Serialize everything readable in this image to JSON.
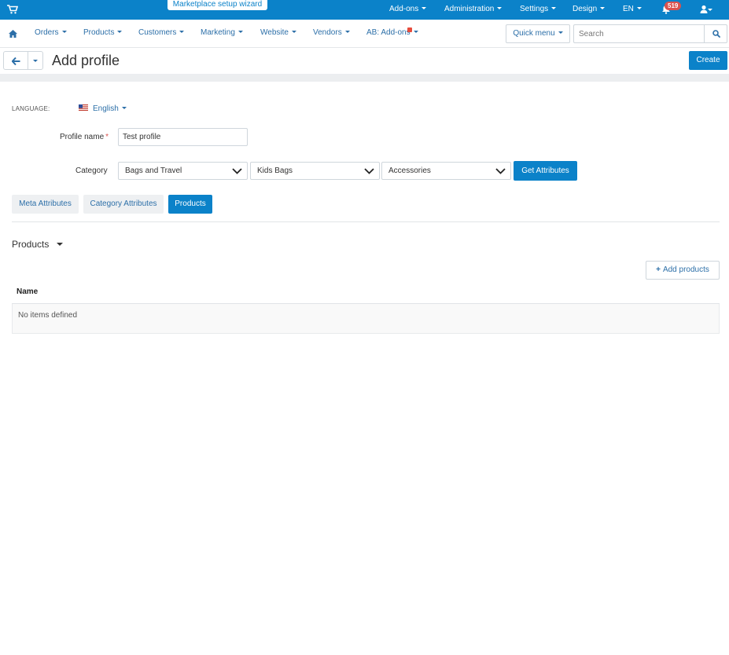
{
  "topbar": {
    "wizard_label": "Marketplace setup wizard",
    "menu": [
      "Add-ons",
      "Administration",
      "Settings",
      "Design",
      "EN"
    ],
    "notification_count": "519",
    "icons": [
      "cart-icon",
      "bell-icon",
      "user-icon"
    ]
  },
  "nav": {
    "items": [
      "Orders",
      "Products",
      "Customers",
      "Marketing",
      "Website",
      "Vendors",
      "AB: Add-ons"
    ],
    "quick_menu_label": "Quick menu",
    "search_placeholder": "Search"
  },
  "title_bar": {
    "title": "Add profile",
    "create_label": "Create"
  },
  "form": {
    "language_label": "LANGUAGE:",
    "language_value": "English",
    "profile_name_label": "Profile name",
    "required_mark": "*",
    "profile_name_value": "Test profile",
    "category_label": "Category",
    "category_selects": [
      "Bags and Travel",
      "Kids Bags",
      "Accessories"
    ],
    "get_attributes_label": "Get Attributes"
  },
  "tabs": [
    {
      "label": "Meta Attributes",
      "active": false
    },
    {
      "label": "Category Attributes",
      "active": false
    },
    {
      "label": "Products",
      "active": true
    }
  ],
  "products_section": {
    "title": "Products",
    "add_button_label": "Add products",
    "column_header": "Name",
    "empty_message": "No items defined"
  },
  "colors": {
    "primary": "#0b82c9",
    "link": "#2c6fa8",
    "badge": "#d9534f"
  }
}
